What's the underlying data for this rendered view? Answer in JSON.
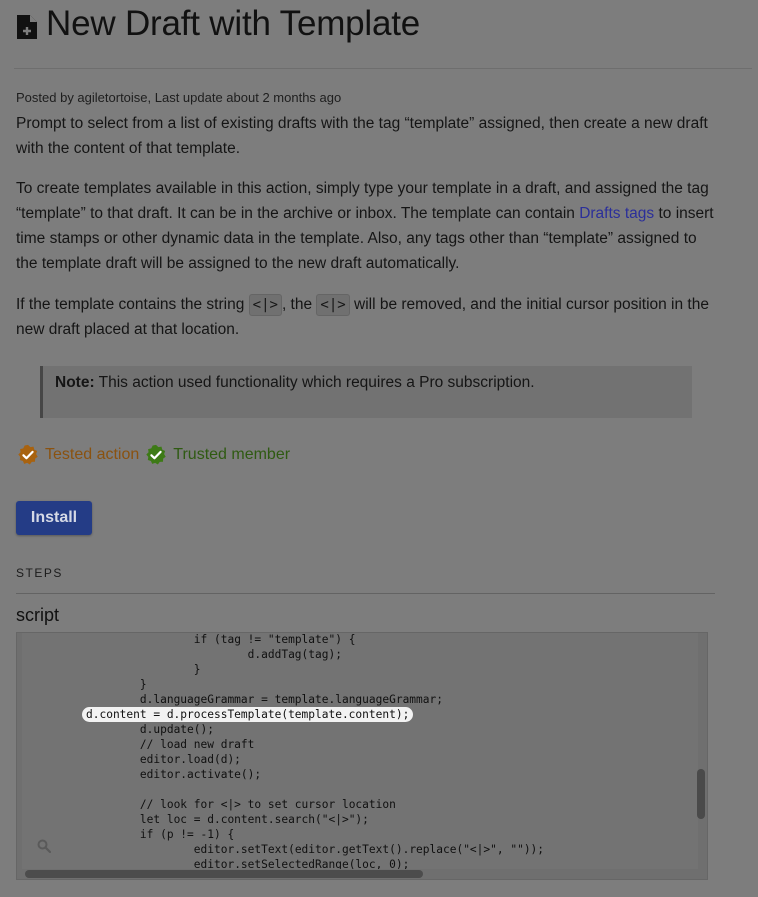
{
  "page": {
    "title": "New Draft with Template",
    "icon": "document-add-icon",
    "meta": "Posted by agiletortoise, Last update about 2 months ago"
  },
  "description": {
    "p1": "Prompt to select from a list of existing drafts with the tag “template” assigned, then create a new draft with the content of that template.",
    "p2_before": "To create templates available in this action, simply type your template in a draft, and assigned the tag “template” to that draft. It can be in the archive or inbox. The template can contain ",
    "p2_link": "Drafts tags",
    "p2_after": " to insert time stamps or other dynamic data in the template. Also, any tags other than “template” assigned to the template draft will be assigned to the new draft automatically.",
    "p3_a": "If the template contains the string ",
    "p3_code1": "<|>",
    "p3_b": ", the ",
    "p3_code2": "<|>",
    "p3_c": " will be removed, and the initial cursor position in the new draft placed at that location."
  },
  "note": {
    "label": "Note:",
    "text": " This action used functionality which requires a Pro subscription."
  },
  "badges": {
    "tested": "Tested action",
    "trusted": "Trusted member",
    "tested_color": "#c17a1c",
    "trusted_color": "#4f9a1e"
  },
  "install_label": "Install",
  "steps_label": "STEPS",
  "script_label": "script",
  "code": {
    "lines_before": "\t\tif (tag != \"template\") {\n\t\t\td.addTag(tag);\n\t\t}\n\t}\n\td.languageGrammar = template.languageGrammar;\n",
    "highlighted": "d.content = d.processTemplate(template.content);",
    "lines_after": "\n\td.update();\n\t// load new draft\n\teditor.load(d);\n\teditor.activate();\n\n\t// look for <|> to set cursor location\n\tlet loc = d.content.search(\"<|>\");\n\tif (p != -1) {\n\t\teditor.setText(editor.getText().replace(\"<|>\", \"\"));\n\t\teditor.setSelectedRange(loc, 0);"
  }
}
